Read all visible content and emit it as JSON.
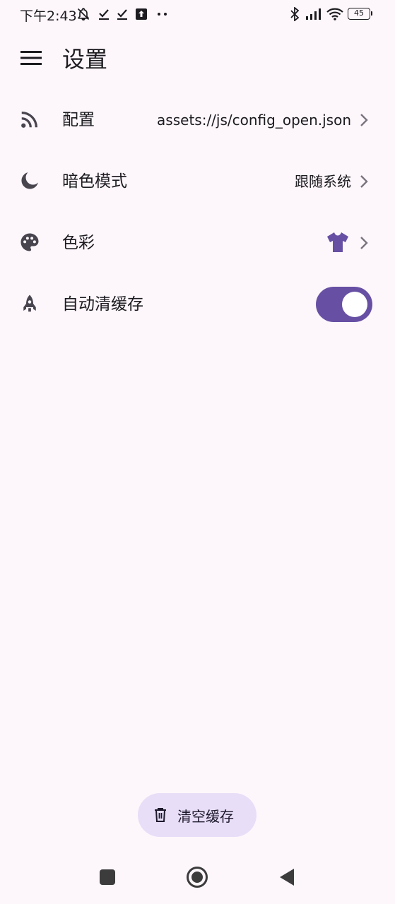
{
  "status_bar": {
    "time": "下午2:43",
    "battery_level": "45",
    "icons": [
      "alarm-off-icon",
      "check-icon",
      "check-icon",
      "upload-icon",
      "more-dots-icon",
      "bluetooth-icon",
      "signal-icon",
      "wifi-icon",
      "battery-icon"
    ]
  },
  "app_bar": {
    "title": "设置",
    "menu_icon": "menu-icon"
  },
  "settings": {
    "items": [
      {
        "label": "配置",
        "value": "assets://js/config_open.json",
        "icon": "rss-feed-icon"
      },
      {
        "label": "暗色模式",
        "value": "跟随系统",
        "icon": "moon-icon"
      },
      {
        "label": "色彩",
        "icon": "palette-icon",
        "value_icon": "tshirt-icon"
      },
      {
        "label": "自动清缓存",
        "icon": "rocket-icon",
        "toggle_on": true
      }
    ]
  },
  "fab": {
    "label": "清空缓存",
    "icon": "trash-icon"
  },
  "colors": {
    "background": "#fdf7fc",
    "primary": "#6750a4",
    "fab_background": "#e8def8",
    "icon": "#49454f"
  },
  "nav_bar": {
    "icons": [
      "recent-apps-icon",
      "home-icon",
      "back-icon"
    ]
  }
}
